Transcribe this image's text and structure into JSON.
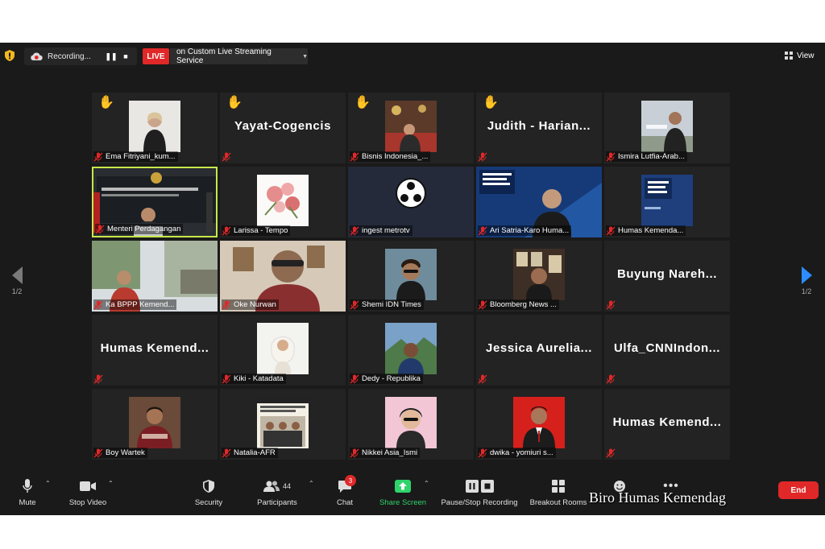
{
  "recording": {
    "label": "Recording...",
    "pause_icon": "pause-icon",
    "stop_icon": "stop-icon"
  },
  "live": {
    "badge": "LIVE",
    "stream_label": "on Custom Live Streaming Service"
  },
  "view": {
    "label": "View"
  },
  "pager": {
    "left": "1/2",
    "right": "1/2"
  },
  "tiles": [
    {
      "label": "Ema Fitriyani_kum...",
      "hand": "✋"
    },
    {
      "label": "",
      "big_name": "Yayat-Cogencis",
      "hand": "✋"
    },
    {
      "label": "Bisnis Indonesia_...",
      "hand": "✋"
    },
    {
      "label": "",
      "big_name": "Judith - Harian...",
      "hand": "✋"
    },
    {
      "label": "Ismira Lutfia-Arab..."
    },
    {
      "label": "Menteri Perdagangan",
      "active_speaker": true
    },
    {
      "label": "Larissa - Tempo"
    },
    {
      "label": "ingest metrotv"
    },
    {
      "label": "Ari Satria-Karo Huma..."
    },
    {
      "label": "Humas Kemenda..."
    },
    {
      "label": "Ka BPPP Kemend..."
    },
    {
      "label": "Oke Nurwan"
    },
    {
      "label": "Shemi IDN Times"
    },
    {
      "label": "Bloomberg News ..."
    },
    {
      "label": "",
      "big_name": "Buyung Nareh..."
    },
    {
      "label": "",
      "big_name": "Humas Kemend..."
    },
    {
      "label": "Kiki - Katadata"
    },
    {
      "label": "Dedy - Republika"
    },
    {
      "label": "",
      "big_name": "Jessica Aurelia..."
    },
    {
      "label": "",
      "big_name": "Ulfa_CNNIndon..."
    },
    {
      "label": "Boy Wartek"
    },
    {
      "label": "Natalia-AFR"
    },
    {
      "label": "Nikkei Asia_Ismi"
    },
    {
      "label": "dwika - yomiuri s..."
    },
    {
      "label": "",
      "big_name": "Humas Kemend..."
    }
  ],
  "toolbar": {
    "mute": "Mute",
    "stop_video": "Stop Video",
    "security": "Security",
    "participants": "Participants",
    "participants_count": "44",
    "chat": "Chat",
    "chat_badge": "3",
    "share_screen": "Share Screen",
    "pause_stop_recording": "Pause/Stop Recording",
    "breakout_rooms": "Breakout Rooms",
    "end": "End"
  },
  "watermark": "Biro Humas Kemendag",
  "colors": {
    "accent_blue": "#2d8cff",
    "live_red": "#e02828",
    "share_green": "#2fd36b",
    "speaker_border": "#c8e84a"
  }
}
